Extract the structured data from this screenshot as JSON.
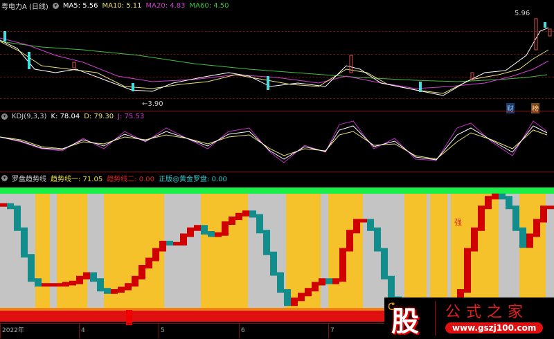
{
  "main_chart": {
    "title": "粤电力A (日线)",
    "ma5": "MA5: 5.56",
    "ma10": "MA10: 5.11",
    "ma20": "MA20: 4.83",
    "ma60": "MA60: 4.50",
    "high_label": "5.96",
    "low_label": "3.90",
    "marker_cai": "财",
    "marker_bang": "榜",
    "colors": {
      "ma5": "#ffffff",
      "ma10": "#e8e07a",
      "ma20": "#d040d0",
      "ma60": "#40c040"
    }
  },
  "kdj": {
    "title": "KDJ(9,3,3)",
    "k": "K: 78.04",
    "d": "D: 79.30",
    "j": "J: 75.53"
  },
  "indicator": {
    "title": "罗盘趋势线",
    "line1": "趋势线一: 71.05",
    "line2": "趋势线二: 0.00",
    "line3": "正版@黄金罗盘: 0.00",
    "strong_label": "强",
    "trend_values": [
      91,
      89,
      71,
      49,
      29,
      25,
      25,
      25,
      25,
      26,
      27,
      31,
      34,
      29,
      21,
      19,
      20,
      22,
      25,
      31,
      40,
      46,
      54,
      60,
      59,
      59,
      66,
      71,
      73,
      68,
      66,
      67,
      76,
      80,
      83,
      85,
      82,
      69,
      51,
      34,
      20,
      9,
      13,
      17,
      21,
      26,
      29,
      27,
      29,
      54,
      69,
      78,
      78,
      71,
      54,
      31,
      14,
      0,
      0,
      0,
      0,
      0,
      0,
      0,
      0,
      0,
      20,
      54,
      71,
      89,
      97,
      99,
      97,
      89,
      71,
      57,
      66,
      78,
      89,
      89
    ],
    "colors": {
      "up": "#d00000",
      "down": "#138c8c",
      "yellow": "#f5c22c",
      "gray": "#c4c4c4",
      "top_band": "#18f048"
    }
  },
  "x_axis": {
    "labels": [
      "2022年",
      "4",
      "5",
      "6",
      "7"
    ]
  },
  "watermark": {
    "char": "股",
    "name": "公式之家",
    "url": "www.gszj100.com"
  }
}
